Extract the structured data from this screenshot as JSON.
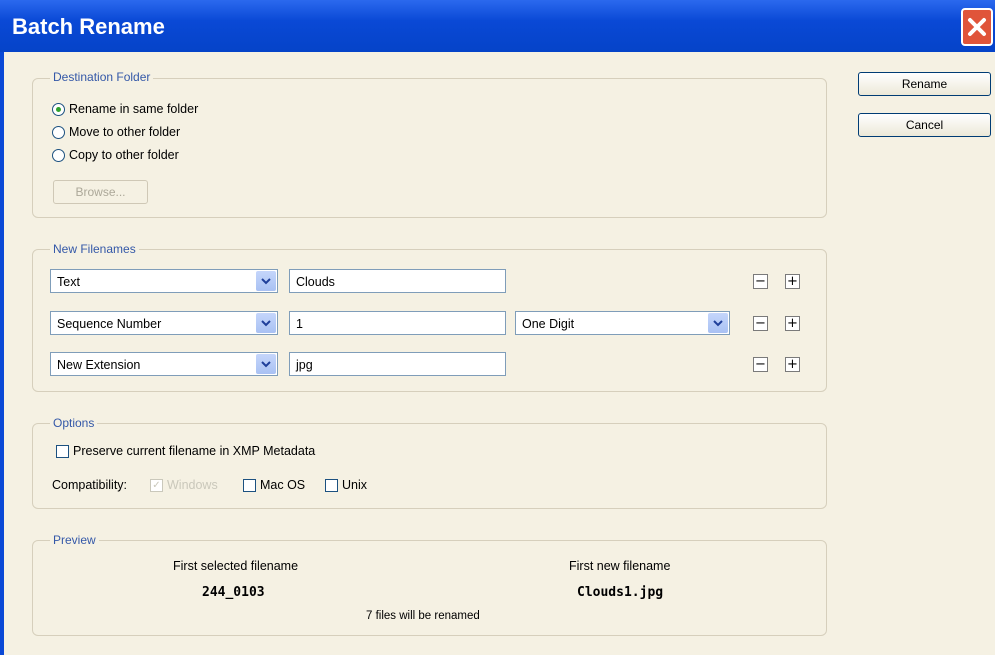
{
  "window": {
    "title": "Batch Rename"
  },
  "destination": {
    "label": "Destination Folder",
    "options": [
      "Rename in same folder",
      "Move to other folder",
      "Copy to other folder"
    ],
    "selected_index": 0,
    "browse_label": "Browse..."
  },
  "actions": {
    "rename": "Rename",
    "cancel": "Cancel"
  },
  "new_filenames": {
    "label": "New Filenames",
    "rows": [
      {
        "type": "Text",
        "value": "Clouds"
      },
      {
        "type": "Sequence Number",
        "value": "1",
        "digits": "One Digit"
      },
      {
        "type": "New Extension",
        "value": "jpg"
      }
    ],
    "minus": "−",
    "plus": "+"
  },
  "options": {
    "label": "Options",
    "preserve": "Preserve current filename in XMP Metadata",
    "compat_label": "Compatibility:",
    "windows": "Windows",
    "macos": "Mac OS",
    "unix": "Unix",
    "windows_check": "✓"
  },
  "preview": {
    "label": "Preview",
    "first_selected_label": "First selected filename",
    "first_selected": "244_0103",
    "first_new_label": "First new filename",
    "first_new": "Clouds1.jpg",
    "summary": "7 files will be renamed"
  }
}
